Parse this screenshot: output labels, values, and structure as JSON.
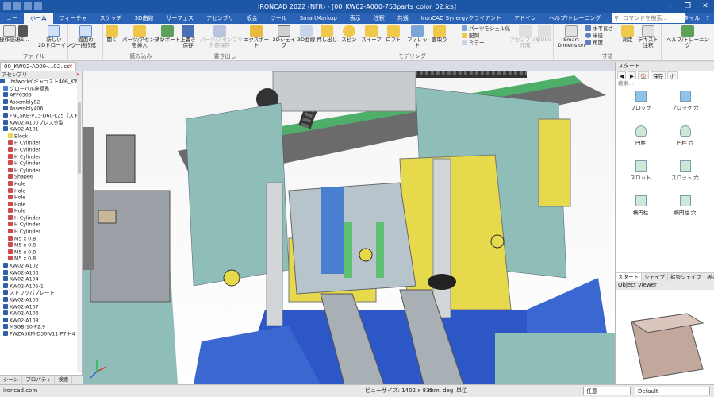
{
  "window": {
    "title": "IRONCAD 2022 (NFR) - [00_KW02-A000-753parts_color_02.ics]"
  },
  "ribbon_tabs": [
    "ュー",
    "ホーム",
    "フィーチャ",
    "スケッチ",
    "3D曲線",
    "サーフェス",
    "アセンブリ",
    "板金",
    "ツール",
    "SmartMarkup",
    "表示",
    "注釈",
    "共通",
    "IronCAD Synergyクライアント",
    "アドイン",
    "ヘルプ/トレーニング"
  ],
  "ribbon_search_placeholder": "コマンドを検索...",
  "ribbon_right": {
    "style": "スタイル"
  },
  "ribbon": {
    "file": {
      "label": "ファイル",
      "buttons": [
        "操作読込",
        "RS...",
        "新しい\n2Dドローイング",
        "図面の\n一括作成"
      ]
    },
    "import": {
      "label": "読み込み",
      "buttons": [
        "開く",
        "パーツ/アセンブリ\nを挿入",
        "インポート"
      ]
    },
    "save": {
      "label": "書き出し",
      "buttons": [
        "上書き\n保存",
        "パーツ/アセンブリ\n外部保存",
        "エクスポート"
      ]
    },
    "modeling": {
      "label": "モデリング",
      "buttons": [
        "2Dシェイプ",
        "3D曲線",
        "押し出し",
        "スピン",
        "スイープ",
        "ロフト",
        "フィレット",
        "面取り"
      ],
      "small": [
        "パーツをシェル化",
        "配列",
        "ミラー"
      ],
      "disabled": [
        "アセンブリを作成",
        "3Dbit"
      ]
    },
    "measure": {
      "label": "寸法",
      "buttons": [
        "Smart\nDimension",
        "測定",
        "テキスト\n注釈"
      ],
      "small": [
        "水平長さ",
        "半径",
        "角度"
      ]
    },
    "help": {
      "buttons": [
        "ヘルプ/トレーニング"
      ]
    }
  },
  "doc_tab": "00_KW02-A000-...02.ics",
  "left_panel": {
    "header": "アセンブリ",
    "tree": [
      "...ts\\works\\ギャラスト406_KW02-A000-753p",
      "グローバル座標系",
      "APP0505",
      "Assembly82",
      "Assembly406",
      "FNCSKB-V13-D60-L25（ストッパ）",
      "KW02-A100プレス金型",
      "KW02-A101",
      "Block",
      "H Cylinder",
      "H Cylinder",
      "H Cylinder",
      "H Cylinder",
      "H Cylinder",
      "Shape6",
      "Hole",
      "Hole",
      "Hole",
      "Hole",
      "Hole",
      "H Cylinder",
      "H Cylinder",
      "H Cylinder",
      "M5 x 0.8",
      "M5 x 0.8",
      "M5 x 0.8",
      "M5 x 0.8",
      "KW02-A102",
      "KW02-A103",
      "KW02-A104",
      "KW02-A105-1",
      "ストリッパプレート",
      "KW02-A106",
      "KW02-A107",
      "KW02-A106",
      "KW02-A108",
      "MSGB-10-P2.9",
      "FWZA5KM-D36-V11-P7-H4"
    ],
    "bottom_tabs": [
      "シーン",
      "プロパティ",
      "検索"
    ]
  },
  "right_panel": {
    "title": "スタート",
    "tools": [
      "◀",
      "▶",
      "🏠",
      "保存",
      "ボ"
    ],
    "search_placeholder": "検索...",
    "catalog": [
      "ブロック",
      "ブロック 穴",
      "円柱",
      "円柱 穴",
      "スロット",
      "スロット 穴",
      "楕円柱",
      "楕円柱 穴"
    ],
    "tabs": [
      "スタート",
      "シェイプ",
      "拡張シェイプ",
      "板金",
      "アニ"
    ],
    "sub_tabs": [
      "◀",
      "戻る",
      "すべてのカタログ"
    ],
    "object_viewer_title": "Object Viewer"
  },
  "status_bar": {
    "url": "ironcad.com",
    "view_size": "ビューサイズ: 1402 x 835",
    "units": "mm, deg",
    "unit_label": "単位",
    "mode": "任意",
    "style": "Default"
  },
  "colors": {
    "titlebar": "#1e56a6",
    "ribbon_tab_bar": "#2a63b5",
    "machine_teal": "#8fbdb7",
    "machine_gray": "#9a9a9a",
    "machine_yellow": "#e6d94c",
    "machine_blue": "#2b55c6",
    "machine_green": "#5fbf73"
  }
}
